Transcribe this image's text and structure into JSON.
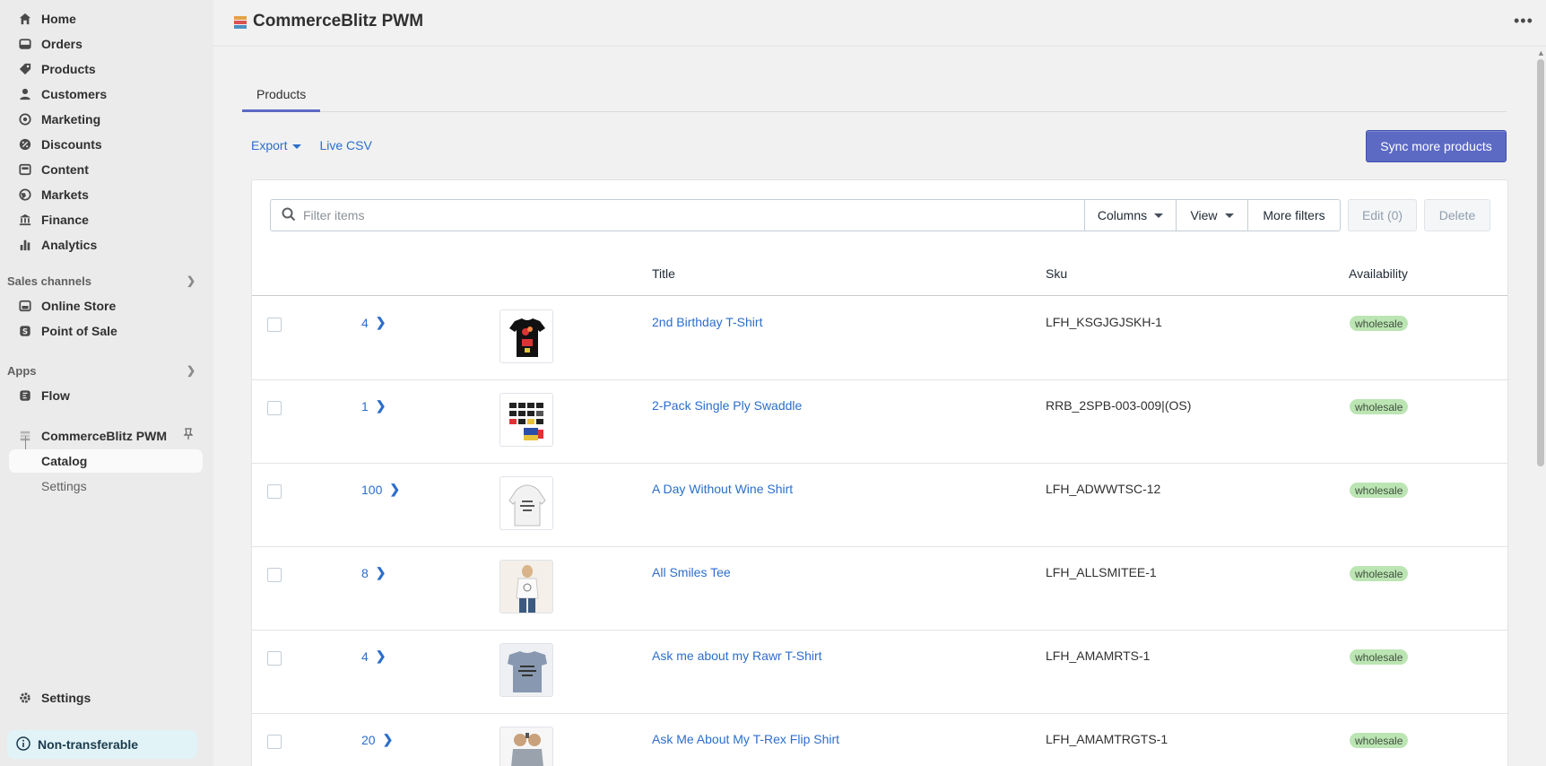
{
  "sidebar": {
    "items": [
      {
        "label": "Home",
        "icon": "home-icon"
      },
      {
        "label": "Orders",
        "icon": "orders-icon"
      },
      {
        "label": "Products",
        "icon": "tag-icon"
      },
      {
        "label": "Customers",
        "icon": "person-icon"
      },
      {
        "label": "Marketing",
        "icon": "target-icon"
      },
      {
        "label": "Discounts",
        "icon": "discount-icon"
      },
      {
        "label": "Content",
        "icon": "content-icon"
      },
      {
        "label": "Markets",
        "icon": "globe-icon"
      },
      {
        "label": "Finance",
        "icon": "bank-icon"
      },
      {
        "label": "Analytics",
        "icon": "bar-chart-icon"
      }
    ],
    "sales_channels": {
      "title": "Sales channels",
      "items": [
        {
          "label": "Online Store",
          "icon": "store-icon"
        },
        {
          "label": "Point of Sale",
          "icon": "pos-icon"
        }
      ]
    },
    "apps": {
      "title": "Apps",
      "items": [
        {
          "label": "Flow",
          "icon": "flow-icon"
        }
      ]
    },
    "app_section": {
      "name": "CommerceBlitz PWM",
      "sub_items": [
        {
          "label": "Catalog"
        },
        {
          "label": "Settings"
        }
      ]
    },
    "settings_label": "Settings",
    "non_transferable_label": "Non-transferable"
  },
  "header": {
    "title": "CommerceBlitz PWM"
  },
  "tabs": [
    {
      "label": "Products",
      "active": true
    }
  ],
  "toolbar": {
    "export_label": "Export",
    "live_csv_label": "Live CSV",
    "sync_label": "Sync more products"
  },
  "filters": {
    "search_placeholder": "Filter items",
    "columns_label": "Columns",
    "view_label": "View",
    "more_filters_label": "More filters",
    "edit_label": "Edit (0)",
    "delete_label": "Delete"
  },
  "table": {
    "headers": {
      "title": "Title",
      "sku": "Sku",
      "availability": "Availability"
    },
    "rows": [
      {
        "count": "4",
        "title": "2nd Birthday T-Shirt",
        "sku": "LFH_KSGJGJSKH-1",
        "availability": "wholesale"
      },
      {
        "count": "1",
        "title": "2-Pack Single Ply Swaddle",
        "sku": "RRB_2SPB-003-009|(OS)",
        "availability": "wholesale"
      },
      {
        "count": "100",
        "title": "A Day Without Wine Shirt",
        "sku": "LFH_ADWWTSC-12",
        "availability": "wholesale"
      },
      {
        "count": "8",
        "title": "All Smiles Tee",
        "sku": "LFH_ALLSMITEE-1",
        "availability": "wholesale"
      },
      {
        "count": "4",
        "title": "Ask me about my Rawr T-Shirt",
        "sku": "LFH_AMAMRTS-1",
        "availability": "wholesale"
      },
      {
        "count": "20",
        "title": "Ask Me About My T-Rex Flip Shirt",
        "sku": "LFH_AMAMTRGTS-1",
        "availability": "wholesale"
      }
    ]
  },
  "colors": {
    "primary": "#5c6ac4",
    "link": "#2c6ecb",
    "badge_bg": "#bbe5b3"
  }
}
